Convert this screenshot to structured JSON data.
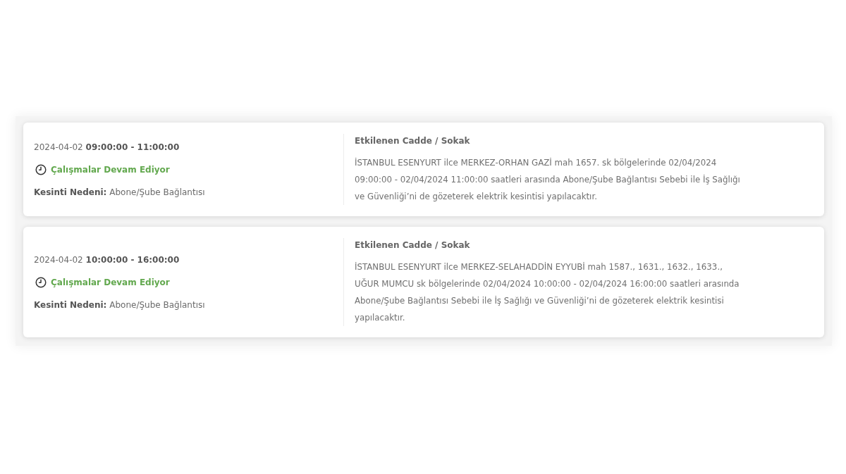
{
  "outages": [
    {
      "time": "2024-04-02 **09:00:00 - 11:00:00**",
      "status": "Çalışmalar Devam Ediyor",
      "reason": "**Kesinti Nedeni:** Abone/Şube Bağlantısı",
      "streets_title": "Etkilenen Cadde / Sokak",
      "description": "İSTANBUL ESENYURT ilce MERKEZ-ORHAN GAZİ mah 1657. sk bölgelerinde 02/04/2024 09:00:00 - 02/04/2024 11:00:00 saatleri arasında Abone/Şube Bağlantısı Sebebi ile İş Sağlığı ve Güvenliği’ni de gözeterek elektrik kesintisi yapılacaktır."
    },
    {
      "time": "2024-04-02 **10:00:00 - 16:00:00**",
      "status": "Çalışmalar Devam Ediyor",
      "reason": "**Kesinti Nedeni:** Abone/Şube Bağlantısı",
      "streets_title": "Etkilenen Cadde / Sokak",
      "description": "İSTANBUL ESENYURT ilce MERKEZ-SELAHADDİN EYYUBİ mah 1587., 1631., 1632., 1633., UĞUR MUMCU sk bölgelerinde 02/04/2024 10:00:00 - 02/04/2024 16:00:00 saatleri arasında Abone/Şube Bağlantısı Sebebi ile İş Sağlığı ve Güvenliği’ni de gözeterek elektrik kesintisi yapılacaktır."
    }
  ]
}
